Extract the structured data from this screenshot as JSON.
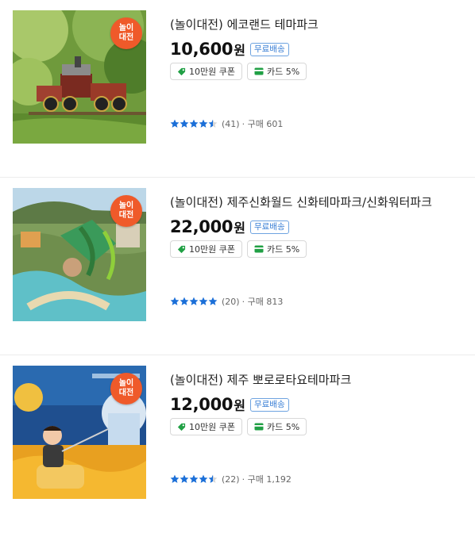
{
  "colors": {
    "badge": "#ef5a2a",
    "star": "#1b6fd8",
    "ship_text": "#3a7fd5",
    "coupon_icon": "#21a045",
    "card_icon": "#21a045"
  },
  "products": [
    {
      "badge_line1": "놀이",
      "badge_line2": "대전",
      "title": "(놀이대전) 에코랜드 테마파크",
      "price": "10,600",
      "won": "원",
      "shipping": "무료배송",
      "coupon": "10만원 쿠폰",
      "card": "카드 5%",
      "rating": 4.5,
      "reviews": "(41)",
      "purchase": "· 구매 601",
      "image_icon": "steam-train-in-forest"
    },
    {
      "badge_line1": "놀이",
      "badge_line2": "대전",
      "title": "(놀이대전) 제주신화월드 신화테마파크/신화워터파크",
      "price": "22,000",
      "won": "원",
      "shipping": "무료배송",
      "coupon": "10만원 쿠폰",
      "card": "카드 5%",
      "rating": 5,
      "reviews": "(20)",
      "purchase": "· 구매 813",
      "image_icon": "waterpark-aerial"
    },
    {
      "badge_line1": "놀이",
      "badge_line2": "대전",
      "title": "(놀이대전) 제주 뽀로로타요테마파크",
      "price": "12,000",
      "won": "원",
      "shipping": "무료배송",
      "coupon": "10만원 쿠폰",
      "card": "카드 5%",
      "rating": 4.5,
      "reviews": "(22)",
      "purchase": "· 구매 1,192",
      "image_icon": "child-in-indoor-playground"
    }
  ]
}
